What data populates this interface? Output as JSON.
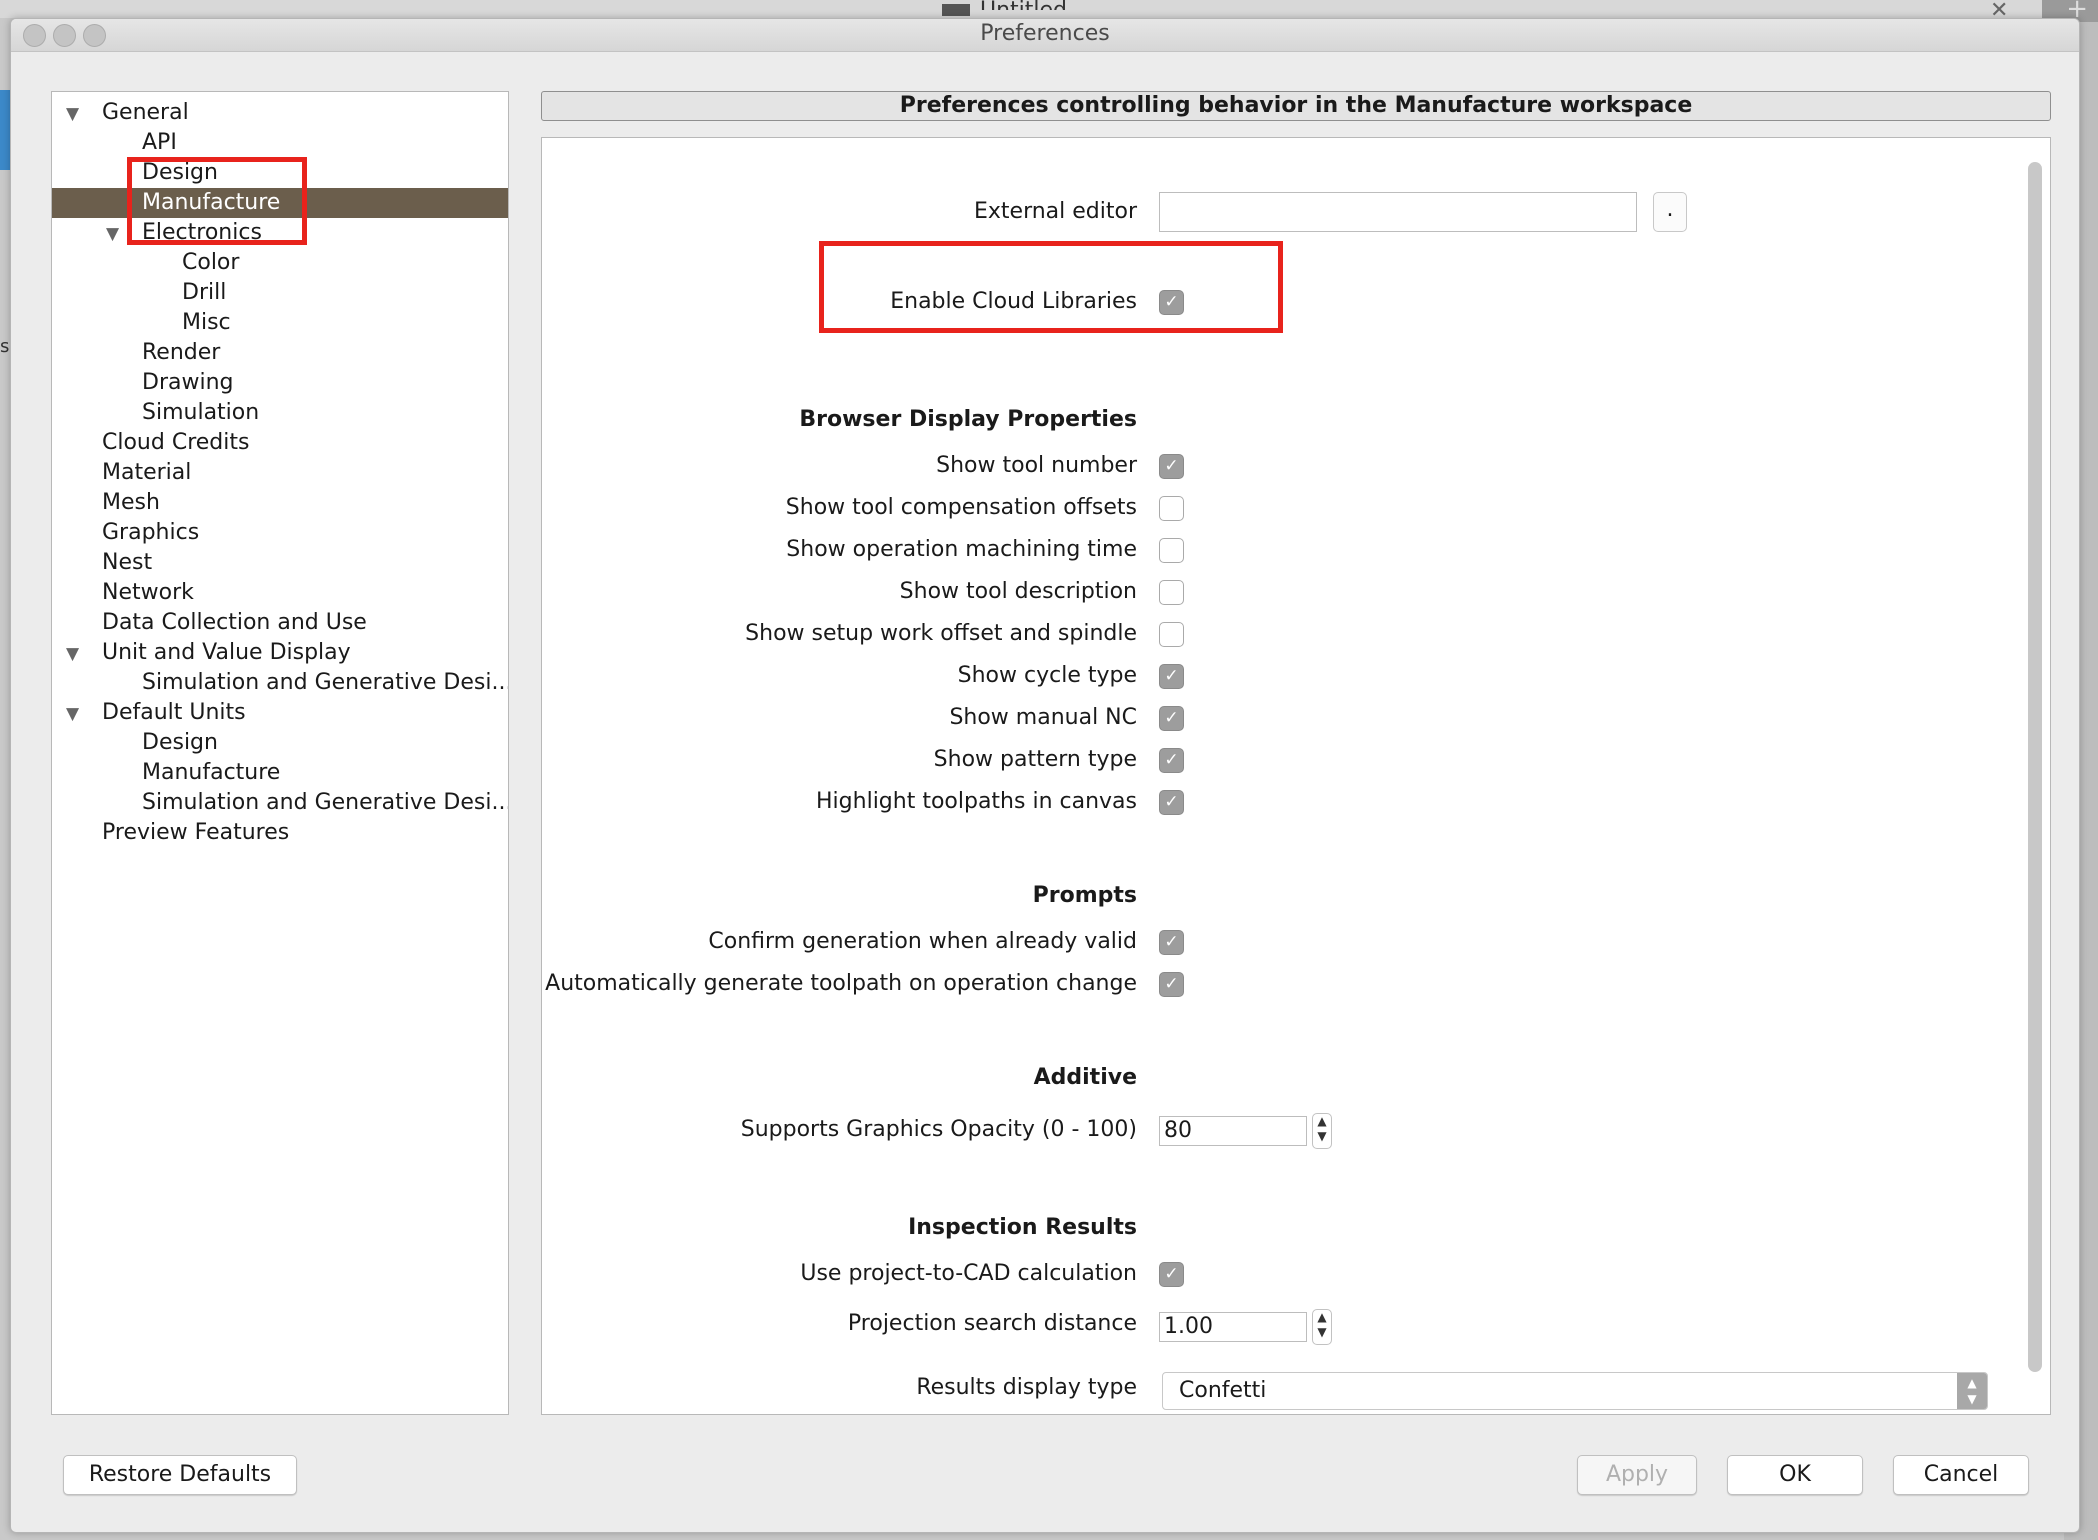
{
  "background": {
    "window_title": "Untitled",
    "left_edge_letter": "s"
  },
  "window": {
    "title": "Preferences"
  },
  "tree": {
    "items": [
      {
        "label": "General",
        "expanded": true
      },
      {
        "label": "API"
      },
      {
        "label": "Design"
      },
      {
        "label": "Manufacture",
        "selected": true
      },
      {
        "label": "Electronics",
        "expanded": true
      },
      {
        "label": "Color"
      },
      {
        "label": "Drill"
      },
      {
        "label": "Misc"
      },
      {
        "label": "Render"
      },
      {
        "label": "Drawing"
      },
      {
        "label": "Simulation"
      },
      {
        "label": "Cloud Credits"
      },
      {
        "label": "Material"
      },
      {
        "label": "Mesh"
      },
      {
        "label": "Graphics"
      },
      {
        "label": "Nest"
      },
      {
        "label": "Network"
      },
      {
        "label": "Data Collection and Use"
      },
      {
        "label": "Unit and Value Display",
        "expanded": true
      },
      {
        "label": "Simulation and Generative Desi..."
      },
      {
        "label": "Default Units",
        "expanded": true
      },
      {
        "label": "Design"
      },
      {
        "label": "Manufacture"
      },
      {
        "label": "Simulation and Generative Desi..."
      },
      {
        "label": "Preview Features"
      }
    ]
  },
  "workspace": {
    "header": "Preferences controlling behavior in the Manufacture workspace",
    "external_editor": {
      "label": "External editor",
      "value": "",
      "browse_label": "."
    },
    "cloud_libraries": {
      "label": "Enable Cloud Libraries",
      "checked": true
    },
    "browser_display": {
      "title": "Browser Display Properties",
      "options": [
        {
          "label": "Show tool number",
          "checked": true
        },
        {
          "label": "Show tool compensation offsets",
          "checked": false
        },
        {
          "label": "Show operation machining time",
          "checked": false
        },
        {
          "label": "Show tool description",
          "checked": false
        },
        {
          "label": "Show setup work offset and spindle",
          "checked": false
        },
        {
          "label": "Show cycle type",
          "checked": true
        },
        {
          "label": "Show manual NC",
          "checked": true
        },
        {
          "label": "Show pattern type",
          "checked": true
        },
        {
          "label": "Highlight toolpaths in canvas",
          "checked": true
        }
      ]
    },
    "prompts": {
      "title": "Prompts",
      "options": [
        {
          "label": "Confirm generation when already valid",
          "checked": true
        },
        {
          "label": "Automatically generate toolpath on operation change",
          "checked": true
        }
      ]
    },
    "additive": {
      "title": "Additive",
      "opacity_label": "Supports Graphics Opacity (0 - 100)",
      "opacity_value": "80"
    },
    "inspection": {
      "title": "Inspection Results",
      "project_to_cad": {
        "label": "Use project-to-CAD calculation",
        "checked": true
      },
      "search_distance_label": "Projection search distance",
      "search_distance_value": "1.00",
      "display_type_label": "Results display type",
      "display_type_value": "Confetti"
    }
  },
  "buttons": {
    "restore": "Restore Defaults",
    "apply": "Apply",
    "ok": "OK",
    "cancel": "Cancel"
  },
  "colors": {
    "selection": "#6b5e4c",
    "highlight_annotation": "#e8231c",
    "checkbox_checked": "#9d9d9d"
  }
}
